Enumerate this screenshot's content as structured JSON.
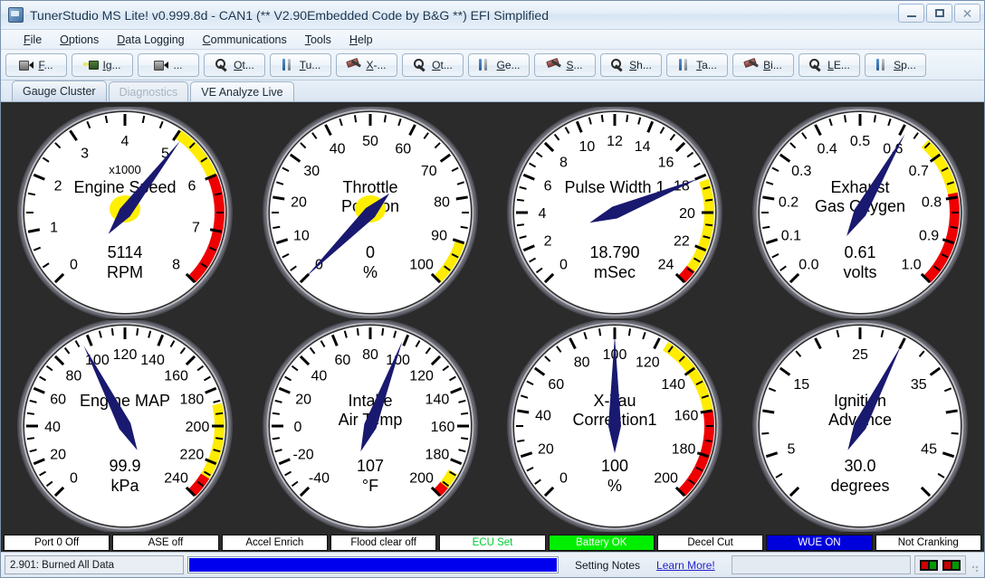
{
  "window": {
    "title": "TunerStudio MS Lite! v0.999.8d - CAN1 (** V2.90Embedded Code by B&G **) EFI Simplified",
    "minimize_label": "Minimize",
    "maximize_label": "Restore",
    "close_label": "Close"
  },
  "menu": {
    "items": [
      {
        "label": "File",
        "mnemonic": "F"
      },
      {
        "label": "Options",
        "mnemonic": "O"
      },
      {
        "label": "Data Logging",
        "mnemonic": "D"
      },
      {
        "label": "Communications",
        "mnemonic": "C"
      },
      {
        "label": "Tools",
        "mnemonic": "T"
      },
      {
        "label": "Help",
        "mnemonic": "H"
      }
    ]
  },
  "toolbar": {
    "buttons": [
      {
        "label": "F...",
        "icon": "burn-icon"
      },
      {
        "label": "Ig...",
        "icon": "ignition-icon"
      },
      {
        "label": "...",
        "icon": "burn-icon"
      },
      {
        "label": "Ot...",
        "icon": "wrench-icon"
      },
      {
        "label": "Tu...",
        "icon": "tools-icon"
      },
      {
        "label": "X-...",
        "icon": "hammer-icon"
      },
      {
        "label": "Ot...",
        "icon": "wrench-icon"
      },
      {
        "label": "Ge...",
        "icon": "tools-icon"
      },
      {
        "label": "S...",
        "icon": "hammer-icon"
      },
      {
        "label": "Sh...",
        "icon": "wrench-icon"
      },
      {
        "label": "Ta...",
        "icon": "tools-icon"
      },
      {
        "label": "Bi...",
        "icon": "hammer-icon"
      },
      {
        "label": "LE...",
        "icon": "wrench-icon"
      },
      {
        "label": "Sp...",
        "icon": "tools-icon"
      }
    ]
  },
  "tabs": [
    {
      "label": "Gauge Cluster",
      "state": "active"
    },
    {
      "label": "Diagnostics",
      "state": "disabled"
    },
    {
      "label": "VE Analyze Live",
      "state": "normal"
    }
  ],
  "gauges": [
    {
      "name": "Engine Speed",
      "title_lines": [
        "Engine Speed"
      ],
      "subtitle": "x1000",
      "value_text": "5114",
      "units": "RPM",
      "value": 5114,
      "min": 0,
      "max": 8000,
      "tick_labels": [
        "0",
        "1",
        "2",
        "3",
        "4",
        "5",
        "6",
        "7",
        "8"
      ],
      "major_count": 9,
      "minor_per_major": 2,
      "warn_start": 5000,
      "warn_end": 6000,
      "danger_start": 6000,
      "danger_end": 8000
    },
    {
      "name": "Throttle Position",
      "title_lines": [
        "Throttle",
        "Position"
      ],
      "subtitle": "",
      "value_text": "0",
      "units": "%",
      "value": 0,
      "min": 0,
      "max": 100,
      "tick_labels": [
        "0",
        "10",
        "20",
        "30",
        "40",
        "50",
        "60",
        "70",
        "80",
        "90",
        "100"
      ],
      "major_count": 11,
      "minor_per_major": 2,
      "warn_start": 90,
      "warn_end": 100,
      "danger_start": 100,
      "danger_end": 100
    },
    {
      "name": "Pulse Width 1",
      "title_lines": [
        "Pulse Width 1"
      ],
      "subtitle": "",
      "value_text": "18.790",
      "units": "mSec",
      "value": 18.79,
      "min": 0,
      "max": 25,
      "tick_labels": [
        "0",
        "2",
        "4",
        "6",
        "8",
        "10",
        "12",
        "14",
        "16",
        "18",
        "20",
        "22",
        "24"
      ],
      "major_count": 13,
      "minor_per_major": 2,
      "warn_start": 19,
      "warn_end": 24.2,
      "danger_start": 24.2,
      "danger_end": 25
    },
    {
      "name": "Exhaust Gas Oxygen",
      "title_lines": [
        "Exhaust",
        "Gas Oxygen"
      ],
      "subtitle": "",
      "value_text": "0.61",
      "units": "volts",
      "value": 0.61,
      "min": 0,
      "max": 1.0,
      "tick_labels": [
        "0.0",
        "0.1",
        "0.2",
        "0.3",
        "0.4",
        "0.5",
        "0.6",
        "0.7",
        "0.8",
        "0.9",
        "1.0"
      ],
      "major_count": 11,
      "minor_per_major": 2,
      "warn_start": 0.66,
      "warn_end": 0.79,
      "danger_start": 0.79,
      "danger_end": 1.0
    },
    {
      "name": "Engine MAP",
      "title_lines": [
        "Engine MAP"
      ],
      "subtitle": "",
      "value_text": "99.9",
      "units": "kPa",
      "value": 99.9,
      "min": 0,
      "max": 250,
      "tick_labels": [
        "0",
        "20",
        "40",
        "60",
        "80",
        "100",
        "120",
        "140",
        "160",
        "180",
        "200",
        "220",
        "240"
      ],
      "major_count": 13,
      "minor_per_major": 2,
      "warn_start": 196,
      "warn_end": 238,
      "danger_start": 238,
      "danger_end": 250
    },
    {
      "name": "Intake Air Temp",
      "title_lines": [
        "Intake",
        "Air Temp"
      ],
      "subtitle": "",
      "value_text": "107",
      "units": "°F",
      "value": 107,
      "min": -40,
      "max": 215,
      "tick_labels": [
        "-40",
        "-20",
        "0",
        "20",
        "40",
        "60",
        "80",
        "100",
        "120",
        "140",
        "160",
        "180",
        "200"
      ],
      "major_count": 13,
      "minor_per_major": 2,
      "warn_start": 200,
      "warn_end": 209,
      "danger_start": 209,
      "danger_end": 215
    },
    {
      "name": "X-Tau Correction1",
      "title_lines": [
        "X-Tau",
        "Correction1"
      ],
      "subtitle": "",
      "value_text": "100",
      "units": "%",
      "value": 100,
      "min": 0,
      "max": 200,
      "tick_labels": [
        "0",
        "20",
        "40",
        "60",
        "80",
        "100",
        "120",
        "140",
        "160",
        "180",
        "200"
      ],
      "major_count": 11,
      "minor_per_major": 2,
      "warn_start": 124,
      "warn_end": 160,
      "danger_start": 160,
      "danger_end": 200
    },
    {
      "name": "Ignition Advance",
      "title_lines": [
        "Ignition",
        "Advance"
      ],
      "subtitle": "",
      "value_text": "30.0",
      "units": "degrees",
      "value": 30.0,
      "min": 0,
      "max": 50,
      "tick_labels": [
        "",
        "5",
        "",
        "15",
        "",
        "25",
        "",
        "35",
        "",
        "45",
        ""
      ],
      "major_count": 11,
      "minor_per_major": 1,
      "warn_start": 50,
      "warn_end": 50,
      "danger_start": 50,
      "danger_end": 50
    }
  ],
  "status_indicators": [
    {
      "label": "Port 0 Off",
      "bg": "#ffffff",
      "fg": "#000000"
    },
    {
      "label": "ASE off",
      "bg": "#ffffff",
      "fg": "#000000"
    },
    {
      "label": "Accel Enrich",
      "bg": "#ffffff",
      "fg": "#000000"
    },
    {
      "label": "Flood clear off",
      "bg": "#ffffff",
      "fg": "#000000"
    },
    {
      "label": "ECU Set",
      "bg": "#ffffff",
      "fg": "#00cc33"
    },
    {
      "label": "Battery OK",
      "bg": "#00ee00",
      "fg": "#ffffff"
    },
    {
      "label": "Decel Cut",
      "bg": "#ffffff",
      "fg": "#000000"
    },
    {
      "label": "WUE ON",
      "bg": "#0000dd",
      "fg": "#ffffff"
    },
    {
      "label": "Not Cranking",
      "bg": "#ffffff",
      "fg": "#000000"
    }
  ],
  "bottom_bar": {
    "status_text": "2.901: Burned All Data",
    "progress_percent": 100,
    "progress_color": "#0000ee",
    "notes_label": "Setting Notes",
    "learn_more_label": "Learn More!",
    "leds": [
      {
        "left": "#cc0000",
        "right": "#009900"
      },
      {
        "left": "#cc0000",
        "right": "#009900"
      }
    ]
  },
  "colors": {
    "gauge_face": "#ffffff",
    "gauge_bezel": "#8c8c93",
    "needle": "#191970",
    "hub": "#ffef00",
    "warn": "#ffec00",
    "danger": "#ee0000",
    "panel_bg": "#2b2b2b"
  }
}
